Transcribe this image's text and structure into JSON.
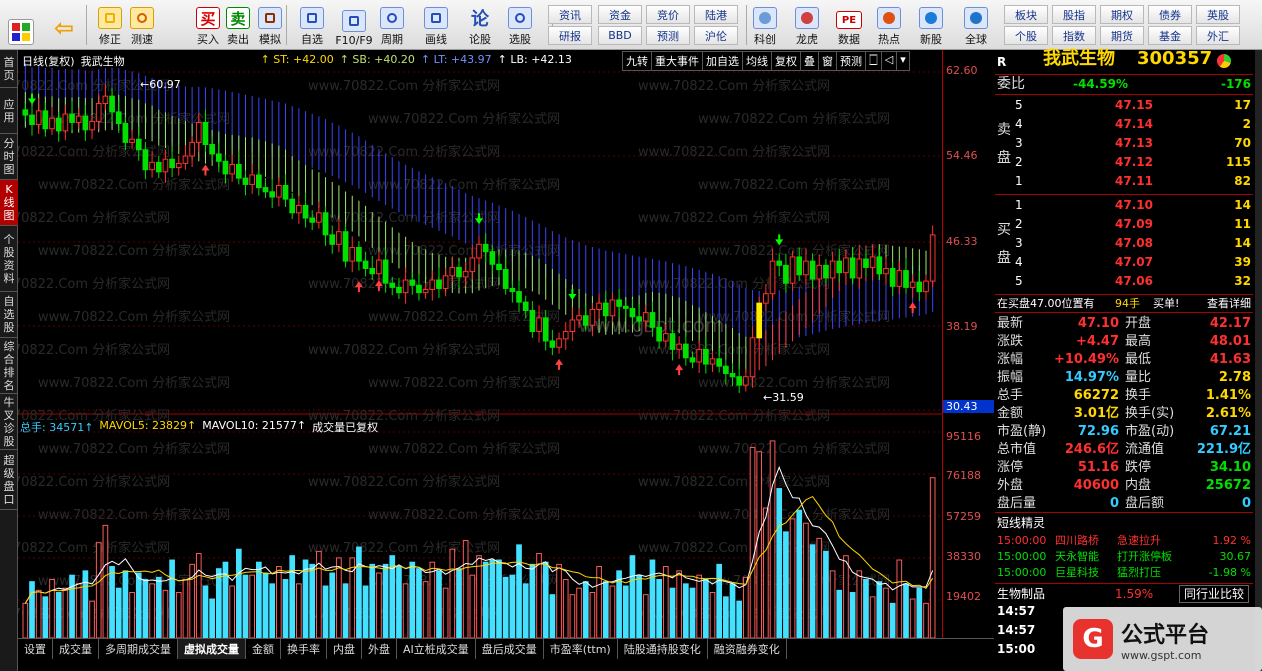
{
  "toolbar": {
    "main": [
      {
        "label": "修正",
        "icon": "fix-icon"
      },
      {
        "label": "测速",
        "icon": "speed-icon"
      },
      {
        "label": "买入",
        "icon": "buy-icon"
      },
      {
        "label": "卖出",
        "icon": "sell-icon"
      },
      {
        "label": "模拟",
        "icon": "hammer-icon"
      },
      {
        "label": "自选",
        "icon": "favorites-icon"
      },
      {
        "label": "F10/F9",
        "icon": "f10-icon"
      },
      {
        "label": "周期",
        "icon": "period-icon"
      },
      {
        "label": "画线",
        "icon": "draw-icon"
      },
      {
        "label": "论股",
        "icon": "forum-icon"
      },
      {
        "label": "选股",
        "icon": "pick-icon"
      }
    ],
    "icon_buy": "买",
    "icon_sell": "卖",
    "icon_forum": "论",
    "quick": [
      "资讯",
      "资金",
      "竞价",
      "陆港",
      "研报",
      "BBD",
      "预测",
      "沪伦"
    ],
    "main2": [
      {
        "label": "科创",
        "icon": "kechuang-icon"
      },
      {
        "label": "龙虎",
        "icon": "dragon-icon"
      },
      {
        "label": "数据",
        "icon": "data-icon"
      },
      {
        "label": "热点",
        "icon": "hot-icon"
      },
      {
        "label": "新股",
        "icon": "ipo-icon"
      },
      {
        "label": "全球",
        "icon": "globe-icon"
      }
    ],
    "icon_pe": "PE",
    "quick2": [
      "板块",
      "股指",
      "期权",
      "债券",
      "英股",
      "个股",
      "指数",
      "期货",
      "基金",
      "外汇"
    ]
  },
  "sidebar": [
    "首页",
    "应用",
    "分时图",
    "K线图",
    "个股资料",
    "自选股",
    "综合排名",
    "牛叉诊股",
    "超级盘口"
  ],
  "chart": {
    "title": "日线(复权)",
    "stock": "我武生物",
    "st": "↑ ST: +42.00",
    "sb": "↑ SB: +40.20",
    "lt": "↑ LT: +43.97",
    "lb": "↑ LB: +42.13",
    "buttons": [
      "九转",
      "重大事件",
      "加自选",
      "均线",
      "复权",
      "叠",
      "窗",
      "预测",
      "🀆",
      "◁",
      "▾"
    ],
    "hi_label": "60.97",
    "lo_label": "31.59",
    "price_ticks": [
      "62.60",
      "54.46",
      "46.33",
      "38.19",
      "30.43"
    ],
    "vol_ticks": [
      "95116",
      "76188",
      "57259",
      "38330",
      "19402"
    ],
    "vol_header": {
      "total": "总手: 34571↑",
      "ma5": "MAVOL5: 23829↑",
      "ma10": "MAVOL10: 21577↑",
      "note": "成交量已复权"
    },
    "watermark": "www.70822.Com 分析家公式网",
    "watermark2": "www.gspt.com"
  },
  "bottom_tabs": [
    "设置",
    "成交量",
    "多周期成交量",
    "虚拟成交量",
    "金额",
    "换手率",
    "内盘",
    "外盘",
    "AI立桩成交量",
    "盘后成交量",
    "市盈率(ttm)",
    "陆股通持股变化",
    "融资融券变化"
  ],
  "quote": {
    "name": "我武生物",
    "code": "300357",
    "r": "R",
    "weibi_label": "委比",
    "weibi": "-44.59%",
    "weicha": "-176",
    "sell_label": "卖盘",
    "buy_label": "买盘",
    "sell": [
      [
        "5",
        "47.15",
        "17"
      ],
      [
        "4",
        "47.14",
        "2"
      ],
      [
        "3",
        "47.13",
        "70"
      ],
      [
        "2",
        "47.12",
        "115"
      ],
      [
        "1",
        "47.11",
        "82"
      ]
    ],
    "buy": [
      [
        "1",
        "47.10",
        "14"
      ],
      [
        "2",
        "47.09",
        "11"
      ],
      [
        "3",
        "47.08",
        "14"
      ],
      [
        "4",
        "47.07",
        "39"
      ],
      [
        "5",
        "47.06",
        "32"
      ]
    ],
    "notice": "在买盘47.00位置有",
    "notice_v": "94手",
    "notice_b": "买单!",
    "notice_link": "查看详细",
    "stats": [
      [
        "最新",
        "47.10",
        "开盘",
        "42.17"
      ],
      [
        "涨跌",
        "+4.47",
        "最高",
        "48.01"
      ],
      [
        "涨幅",
        "+10.49%",
        "最低",
        "41.63"
      ],
      [
        "振幅",
        "14.97%",
        "量比",
        "2.78"
      ],
      [
        "总手",
        "66272",
        "换手",
        "1.41%"
      ],
      [
        "金额",
        "3.01亿",
        "换手(实)",
        "2.61%"
      ],
      [
        "市盈(静)",
        "72.96",
        "市盈(动)",
        "67.21"
      ],
      [
        "总市值",
        "246.6亿",
        "流通值",
        "221.9亿"
      ],
      [
        "涨停",
        "51.16",
        "跌停",
        "34.10"
      ],
      [
        "外盘",
        "40600",
        "内盘",
        "25672"
      ],
      [
        "盘后量",
        "0",
        "盘后额",
        "0"
      ]
    ],
    "sprite_title": "短线精灵",
    "sprites": [
      [
        "15:00:00",
        "四川路桥",
        "急速拉升",
        "1.92 %"
      ],
      [
        "15:00:00",
        "天永智能",
        "打开涨停板",
        "30.67"
      ],
      [
        "15:00:00",
        "巨星科技",
        "猛烈打压",
        "-1.98 %"
      ]
    ],
    "industry": "生物制品",
    "industry_pct": "1.59%",
    "compare": "同行业比较",
    "ticks": [
      "14:57",
      "14:57",
      "15:00"
    ]
  },
  "logo": {
    "text": "公式平台",
    "url": "www.gspt.com"
  },
  "colors": {
    "up": "#ff3030",
    "down": "#00e000",
    "vol_up": "#ff5a5a",
    "vol_down": "#44e0ff",
    "band_blue": "#3a44ff",
    "band_green": "#9be86b",
    "band_red": "#ff3c4c"
  },
  "chart_data": {
    "type": "candlestick",
    "price_range": [
      30.43,
      62.6
    ],
    "volume_range": [
      0,
      95116
    ],
    "closes": [
      58.5,
      57.6,
      58.9,
      57.2,
      58.2,
      57.0,
      58.6,
      57.8,
      58.4,
      57.1,
      57.9,
      59.6,
      60.3,
      58.8,
      57.7,
      55.9,
      56.2,
      55.2,
      53.3,
      54.0,
      53.1,
      54.3,
      53.5,
      53.9,
      54.6,
      55.9,
      57.8,
      55.7,
      54.8,
      54.1,
      52.9,
      53.8,
      52.5,
      51.9,
      52.8,
      51.6,
      51.2,
      50.7,
      51.8,
      50.5,
      49.2,
      49.9,
      48.7,
      48.3,
      49.2,
      47.1,
      46.2,
      47.4,
      44.6,
      45.9,
      44.6,
      43.9,
      43.4,
      44.7,
      42.5,
      42.1,
      41.6,
      42.8,
      42.3,
      41.6,
      41.9,
      42.8,
      42.0,
      43.2,
      44.0,
      43.1,
      43.6,
      44.9,
      46.2,
      45.5,
      44.3,
      43.8,
      42.0,
      41.7,
      40.7,
      39.9,
      37.9,
      39.2,
      37.0,
      36.4,
      37.2,
      37.9,
      39.0,
      39.4,
      38.5,
      40.0,
      40.6,
      39.4,
      40.9,
      40.3,
      40.1,
      39.3,
      38.9,
      39.7,
      38.3,
      37.0,
      37.7,
      36.2,
      36.7,
      35.4,
      35.0,
      36.2,
      34.8,
      35.3,
      34.6,
      33.9,
      33.6,
      32.8,
      33.6,
      37.3,
      40.6,
      41.5,
      44.6,
      44.2,
      42.5,
      45.0,
      43.3,
      44.6,
      42.9,
      44.2,
      43.0,
      44.6,
      43.5,
      44.9,
      43.0,
      44.8,
      44.0,
      45.0,
      43.4,
      43.9,
      42.2,
      43.7,
      42.1,
      42.6,
      41.7,
      42.7,
      47.1
    ],
    "volumes": [
      16000,
      26000,
      22000,
      19000,
      27000,
      21000,
      23000,
      29000,
      25000,
      31000,
      17000,
      44000,
      52000,
      33000,
      23000,
      31000,
      21000,
      30000,
      27000,
      25000,
      28000,
      22000,
      36000,
      21000,
      27000,
      34000,
      39000,
      24000,
      18000,
      32000,
      35000,
      24000,
      41000,
      29000,
      29000,
      35000,
      30000,
      25000,
      33000,
      27000,
      38000,
      25000,
      36000,
      34000,
      40000,
      24000,
      30000,
      37000,
      25000,
      37000,
      42000,
      24000,
      34000,
      30000,
      34000,
      38000,
      33000,
      25000,
      35000,
      32000,
      26000,
      35000,
      31000,
      23000,
      41000,
      32000,
      45000,
      29000,
      38000,
      35000,
      36000,
      36000,
      28000,
      29000,
      43000,
      25000,
      34000,
      39000,
      35000,
      20000,
      34000,
      27000,
      20000,
      23000,
      26000,
      21000,
      33000,
      26000,
      24000,
      31000,
      24000,
      38000,
      29000,
      20000,
      36000,
      27000,
      33000,
      23000,
      31000,
      25000,
      23000,
      29000,
      27000,
      21000,
      34000,
      19000,
      25000,
      17000,
      28000,
      88000,
      86000,
      60000,
      91000,
      69000,
      49000,
      55000,
      59000,
      53000,
      43000,
      46000,
      40000,
      31000,
      22000,
      38000,
      21000,
      31000,
      27000,
      19000,
      26000,
      23000,
      16000,
      36000,
      25000,
      18000,
      23000,
      16000,
      74000
    ]
  }
}
